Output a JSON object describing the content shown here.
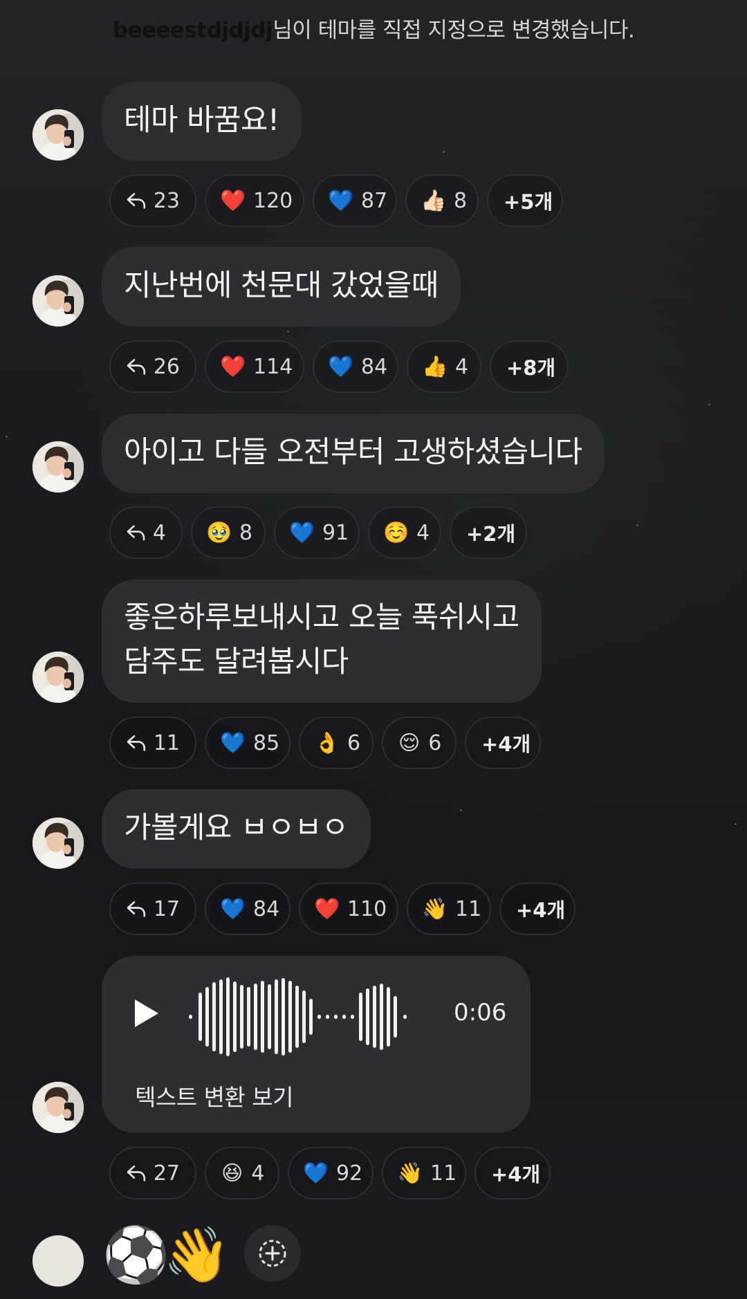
{
  "system_message": {
    "user": "beeeestdjdjdj",
    "text": "님이 테마를 직접 지정으로 변경했습니다."
  },
  "messages": [
    {
      "text_lines": [
        "테마 바꿈요!"
      ],
      "reactions": [
        {
          "type": "reply",
          "count": "23"
        },
        {
          "emoji": "❤️",
          "count": "120"
        },
        {
          "emoji": "💙",
          "count": "87"
        },
        {
          "emoji": "👍🏻",
          "count": "8"
        }
      ],
      "more": "+5개"
    },
    {
      "text_lines": [
        "지난번에 천문대 갔었을때"
      ],
      "reactions": [
        {
          "type": "reply",
          "count": "26"
        },
        {
          "emoji": "❤️",
          "count": "114"
        },
        {
          "emoji": "💙",
          "count": "84"
        },
        {
          "emoji": "👍",
          "count": "4"
        }
      ],
      "more": "+8개"
    },
    {
      "text_lines": [
        "아이고 다들 오전부터 고생하셨습니다"
      ],
      "reactions": [
        {
          "type": "reply",
          "count": "4"
        },
        {
          "emoji": "🥹",
          "count": "8"
        },
        {
          "emoji": "💙",
          "count": "91"
        },
        {
          "emoji": "☺️",
          "count": "4"
        }
      ],
      "more": "+2개"
    },
    {
      "text_lines": [
        "좋은하루보내시고 오늘 푹쉬시고",
        "담주도 달려봅시다"
      ],
      "reactions": [
        {
          "type": "reply",
          "count": "11"
        },
        {
          "emoji": "💙",
          "count": "85"
        },
        {
          "emoji": "👌",
          "count": "6"
        },
        {
          "emoji": "😌",
          "count": "6"
        }
      ],
      "more": "+4개"
    },
    {
      "text_lines": [
        "가볼게요 ㅂㅇㅂㅇ"
      ],
      "reactions": [
        {
          "type": "reply",
          "count": "17"
        },
        {
          "emoji": "💙",
          "count": "84"
        },
        {
          "emoji": "❤️",
          "count": "110"
        },
        {
          "emoji": "👋",
          "count": "11"
        }
      ],
      "more": "+4개"
    },
    {
      "voice": {
        "duration": "0:06",
        "stt_label": "텍스트 변환 보기"
      },
      "reactions": [
        {
          "type": "reply",
          "count": "27"
        },
        {
          "emoji": "😆",
          "count": "4"
        },
        {
          "emoji": "💙",
          "count": "92"
        },
        {
          "emoji": "👋",
          "count": "11"
        }
      ],
      "more": "+4개"
    }
  ],
  "last_message": {
    "emojis": [
      "⚽",
      "👋"
    ],
    "add_reaction_icon": "add-reaction-icon"
  }
}
